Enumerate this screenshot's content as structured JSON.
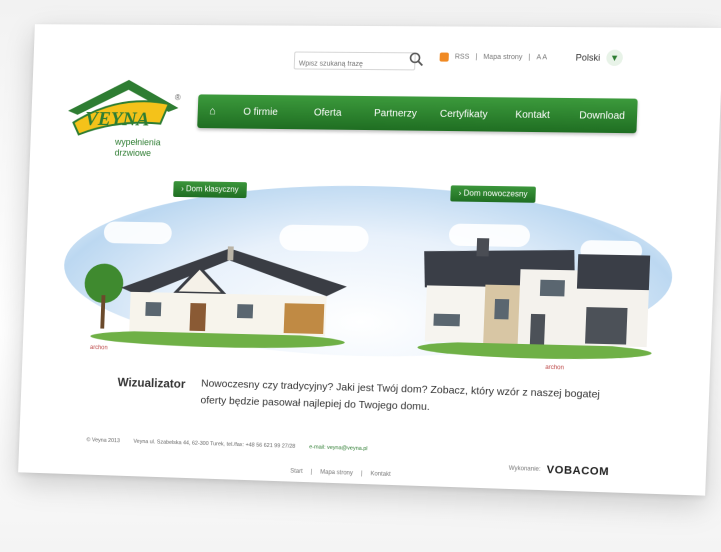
{
  "brand": {
    "logo_text": "VEYNA",
    "tagline_1": "wypełnienia",
    "tagline_2": "drzwiowe",
    "registered": "®"
  },
  "search": {
    "placeholder": "Wpisz szukaną frazę"
  },
  "top_links": {
    "rss": "RSS",
    "sitemap": "Mapa strony",
    "font_size": "A A"
  },
  "language": {
    "selected": "Polski"
  },
  "nav": {
    "home_icon": "home-icon",
    "items": [
      "O firmie",
      "Oferta",
      "Partnerzy",
      "Certyfikaty",
      "Kontakt",
      "Download"
    ]
  },
  "scene": {
    "left_tag": "Dom klasyczny",
    "right_tag": "Dom nowoczesny",
    "left_caption": "archon",
    "right_caption": "archon"
  },
  "wizualizator": {
    "title": "Wizualizator",
    "text": "Nowoczesny czy tradycyjny? Jaki jest Twój dom? Zobacz, który wzór z naszej bogatej oferty będzie pasował najlepiej do Twojego domu."
  },
  "footer": {
    "copyright": "© Veyna 2013",
    "address": "Veyna ul. Szabelska 44, 62-300 Turek, tel./fax: +48 56 621 99 27/28",
    "email": "e-mail: veyna@veyna.pl",
    "author_label": "Wykonanie:",
    "author": "VOBACOM",
    "links": [
      "Start",
      "Mapa strony",
      "Kontakt"
    ]
  },
  "colors": {
    "brand_green": "#2e7d32",
    "nav_green": "#1f6e22",
    "accent_orange": "#f08a24"
  }
}
